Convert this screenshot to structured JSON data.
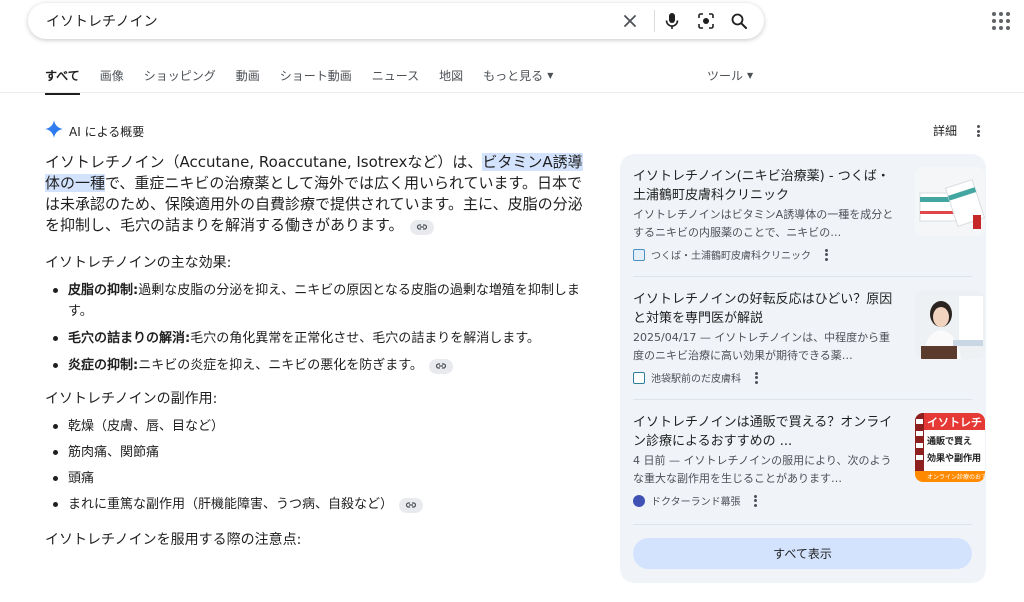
{
  "search": {
    "query": "イソトレチノイン",
    "icons": [
      "close-icon",
      "mic-icon",
      "lens-icon",
      "search-icon"
    ]
  },
  "tabs": [
    {
      "label": "すべて",
      "active": true
    },
    {
      "label": "画像"
    },
    {
      "label": "ショッピング"
    },
    {
      "label": "動画"
    },
    {
      "label": "ショート動画"
    },
    {
      "label": "ニュース"
    },
    {
      "label": "地図"
    },
    {
      "label": "もっと見る"
    }
  ],
  "tools_label": "ツール",
  "ai_overview": {
    "title": "AI による概要",
    "detail_label": "詳細",
    "intro_part1": "イソトレチノイン（Accutane, Roaccutane, Isotrexなど）は、",
    "intro_highlight": "ビタミンA誘導体の一種",
    "intro_part2": "で、重症ニキビの治療薬として海外では広く用いられています。日本では未承認のため、保険適用外の自費診療で提供されています。主に、皮脂の分泌を抑制し、毛穴の詰まりを解消する働きがあります。",
    "effects_title": "イソトレチノインの主な効果:",
    "effects": [
      {
        "term": "皮脂の抑制:",
        "text": "過剰な皮脂の分泌を抑え、ニキビの原因となる皮脂の過剰な増殖を抑制します。"
      },
      {
        "term": "毛穴の詰まりの解消:",
        "text": "毛穴の角化異常を正常化させ、毛穴の詰まりを解消します。"
      },
      {
        "term": "炎症の抑制:",
        "text": "ニキビの炎症を抑え、ニキビの悪化を防ぎます。"
      }
    ],
    "side_effects_title": "イソトレチノインの副作用:",
    "side_effects": [
      "乾燥（皮膚、唇、目など）",
      "筋肉痛、関節痛",
      "頭痛",
      "まれに重篤な副作用（肝機能障害、うつ病、自殺など）"
    ],
    "precautions_title": "イソトレチノインを服用する際の注意点:"
  },
  "sources": [
    {
      "title": "イソトレチノイン(ニキビ治療薬) - つくば・土浦鶴町皮膚科クリニック",
      "snippet": "イソトレチノインはビタミンA誘導体の一種を成分とするニキビの内服薬のことで、ニキビの…",
      "site": "つくば・土浦鶴町皮膚科クリニック",
      "fav_color": "#4a90c2"
    },
    {
      "title": "イソトレチノインの好転反応はひどい？原因と対策を専門医が解説",
      "snippet": "2025/04/17 — イソトレチノインは、中程度から重度のニキビ治療に高い効果が期待できる薬…",
      "site": "池袋駅前のだ皮膚科",
      "fav_color": "#2e7d9a"
    },
    {
      "title": "イソトレチノインは通販で買える？オンライン診療によるおすすめの ...",
      "snippet": "4 日前 — イソトレチノインの服用により、次のような重大な副作用を生じることがあります…",
      "site": "ドクターランド幕張",
      "fav_color": "#3f51b5"
    }
  ],
  "thumb3_text": {
    "line1": "イソトレチ",
    "line2": "通販で買え",
    "line3": "効果や副作用",
    "line4": "オンライン診療のおすすめ"
  },
  "show_all_label": "すべて表示"
}
